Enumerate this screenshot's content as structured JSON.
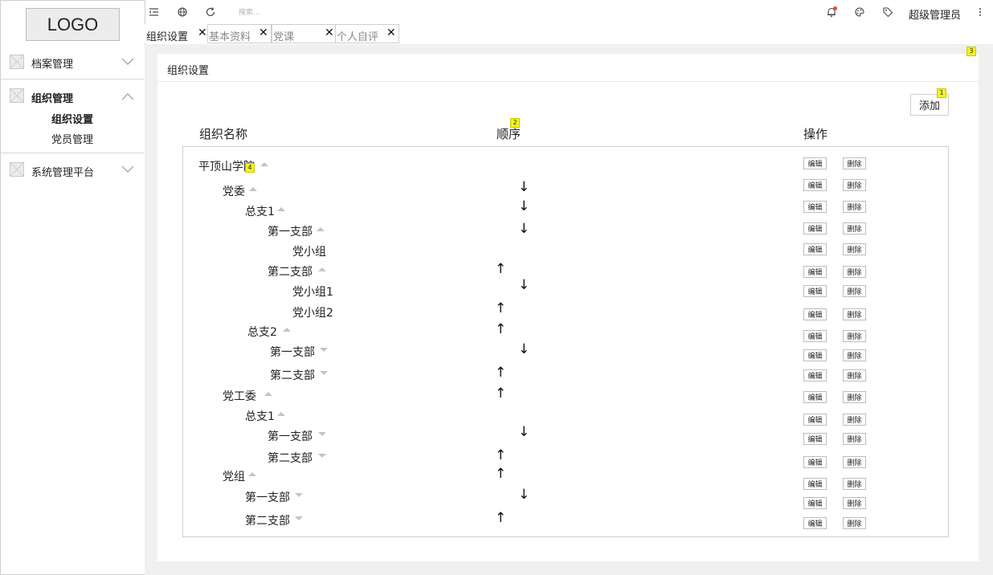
{
  "sidebar": {
    "logo": "LOGO",
    "menus": [
      {
        "label": "档案管理",
        "expanded": false
      },
      {
        "label": "组织管理",
        "expanded": true,
        "children": [
          "组织设置",
          "党员管理"
        ]
      },
      {
        "label": "系统管理平台",
        "expanded": false
      }
    ]
  },
  "topbar": {
    "search_placeholder": "搜索...",
    "user": "超级管理员",
    "icons": [
      "menu-fold-icon",
      "globe-icon",
      "refresh-icon",
      "bell-icon",
      "palette-icon",
      "tag-icon",
      "more-icon"
    ],
    "notification_dot_color": "#f44336"
  },
  "tabs": [
    {
      "label": "组织设置",
      "active": true
    },
    {
      "label": "基本资料",
      "active": false
    },
    {
      "label": "党课",
      "active": false
    },
    {
      "label": "个人自评",
      "active": false
    }
  ],
  "panel": {
    "title": "组织设置",
    "add_label": "添加",
    "columns": [
      "组织名称",
      "顺序",
      "操作"
    ],
    "edit_label": "编辑",
    "delete_label": "删除",
    "badges": [
      "1",
      "2",
      "3",
      "4"
    ],
    "badge_color": "#f4f41c",
    "rows": [
      {
        "name": "平顶山学院",
        "caret": "up",
        "arrow": ""
      },
      {
        "name": "党委",
        "caret": "up",
        "arrow": "↓"
      },
      {
        "name": "总支1",
        "caret": "up",
        "arrow": "↓"
      },
      {
        "name": "第一支部",
        "caret": "up",
        "arrow": "↓"
      },
      {
        "name": "党小组",
        "caret": "",
        "arrow": ""
      },
      {
        "name": "第二支部",
        "caret": "up",
        "arrow": "↑"
      },
      {
        "name": "党小组1",
        "caret": "",
        "arrow": "↓"
      },
      {
        "name": "党小组2",
        "caret": "",
        "arrow": "↑"
      },
      {
        "name": "总支2",
        "caret": "up",
        "arrow": "↑"
      },
      {
        "name": "第一支部",
        "caret": "down",
        "arrow": "↓"
      },
      {
        "name": "第二支部",
        "caret": "down",
        "arrow": "↑"
      },
      {
        "name": "党工委",
        "caret": "up",
        "arrow": "↑"
      },
      {
        "name": "总支1",
        "caret": "up",
        "arrow": ""
      },
      {
        "name": "第一支部",
        "caret": "down",
        "arrow": "↓"
      },
      {
        "name": "第二支部",
        "caret": "down",
        "arrow": "↑"
      },
      {
        "name": "党组",
        "caret": "up",
        "arrow": "↑"
      },
      {
        "name": "第一支部",
        "caret": "down",
        "arrow": "↓"
      },
      {
        "name": "第二支部",
        "caret": "down",
        "arrow": "↑"
      }
    ]
  }
}
